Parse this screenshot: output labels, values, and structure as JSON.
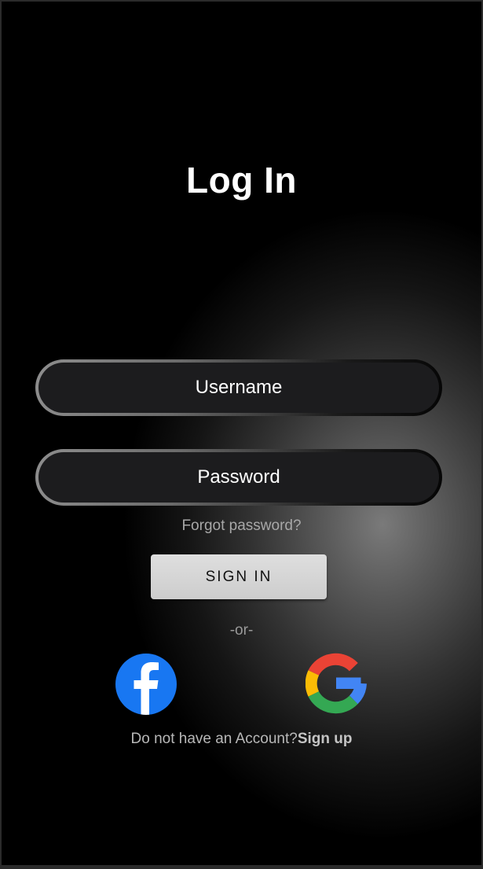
{
  "screen": {
    "title": "Log In",
    "username_label": "Username",
    "password_label": "Password",
    "forgot_password": "Forgot password?",
    "signin_button": "SIGN IN",
    "divider": "-or-",
    "no_account_text": "Do not have an Account?",
    "signup_link": "Sign up"
  },
  "icons": {
    "facebook": "facebook-icon",
    "google": "google-icon"
  },
  "colors": {
    "background": "#000000",
    "field_fill": "#1c1c1e",
    "button_fill": "#d6d6d6",
    "facebook_blue": "#1877F2",
    "google_red": "#EA4335",
    "google_yellow": "#FBBC05",
    "google_green": "#34A853",
    "google_blue": "#4285F4"
  }
}
